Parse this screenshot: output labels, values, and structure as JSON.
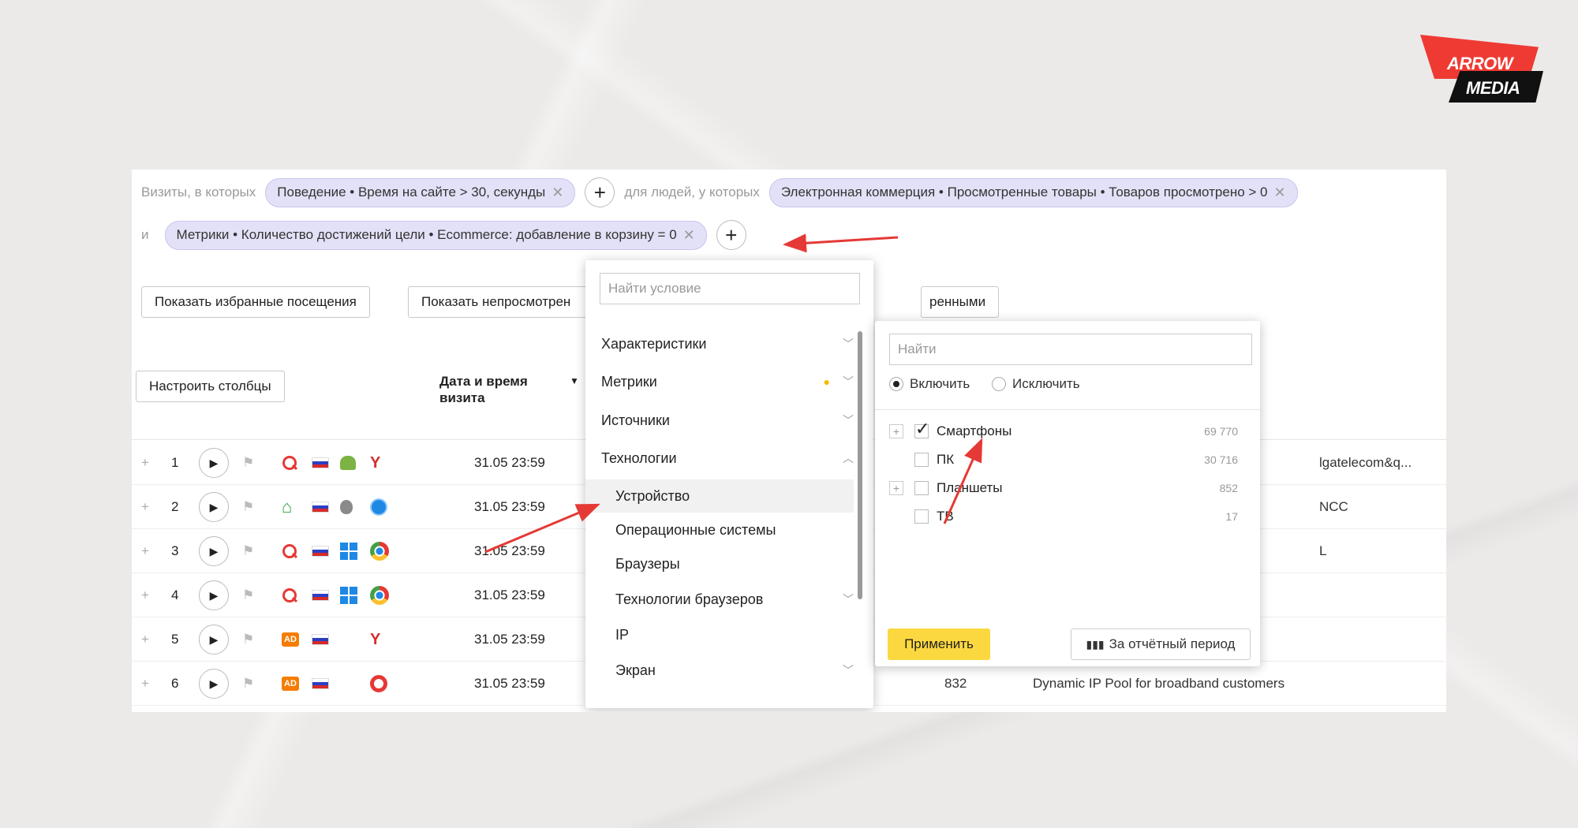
{
  "logo": {
    "line1": "ARROW",
    "line2": "MEDIA"
  },
  "segments": {
    "visits_label": "Визиты, в которых",
    "chip1": "Поведение • Время на сайте > 30, секунды",
    "people_label": "для людей, у которых",
    "chip2": "Электронная коммерция • Просмотренные товары • Товаров просмотрено > 0",
    "and_label": "и",
    "chip3": "Метрики • Количество достижений цели • Ecommerce: добавление в корзину = 0",
    "plus": "+",
    "remove": "✕"
  },
  "buttons": {
    "favorites": "Показать избранные посещения",
    "unviewed": "Показать непросмотрен",
    "hidden_tail": "ренными",
    "columns": "Настроить столбцы"
  },
  "table": {
    "date_header": "Дата и время визита",
    "rows": [
      {
        "n": "1",
        "dt": "31.05 23:59",
        "right": "lgatelecom&q..."
      },
      {
        "n": "2",
        "dt": "31.05 23:59",
        "right": "NCC"
      },
      {
        "n": "3",
        "dt": "31.05 23:59",
        "right": "L"
      },
      {
        "n": "4",
        "dt": "31.05 23:59",
        "right": ""
      },
      {
        "n": "5",
        "dt": "31.05 23:59",
        "right": ""
      },
      {
        "n": "6",
        "dt": "31.05 23:59",
        "right": "Dynamic IP Pool for broadband customers",
        "extra": "832"
      }
    ]
  },
  "dropdown": {
    "search_placeholder": "Найти условие",
    "items": [
      "Характеристики",
      "Метрики",
      "Источники",
      "Технологии",
      "Устройство",
      "Операционные системы",
      "Браузеры",
      "Технологии браузеров",
      "IP",
      "Экран"
    ]
  },
  "subpanel": {
    "search_placeholder": "Найти",
    "include": "Включить",
    "exclude": "Исключить",
    "options": [
      {
        "label": "Смартфоны",
        "count": "69 770",
        "checked": true
      },
      {
        "label": "ПК",
        "count": "30 716",
        "checked": false
      },
      {
        "label": "Планшеты",
        "count": "852",
        "checked": false
      },
      {
        "label": "ТВ",
        "count": "17",
        "checked": false
      }
    ],
    "apply": "Применить",
    "period": "За отчётный период"
  }
}
